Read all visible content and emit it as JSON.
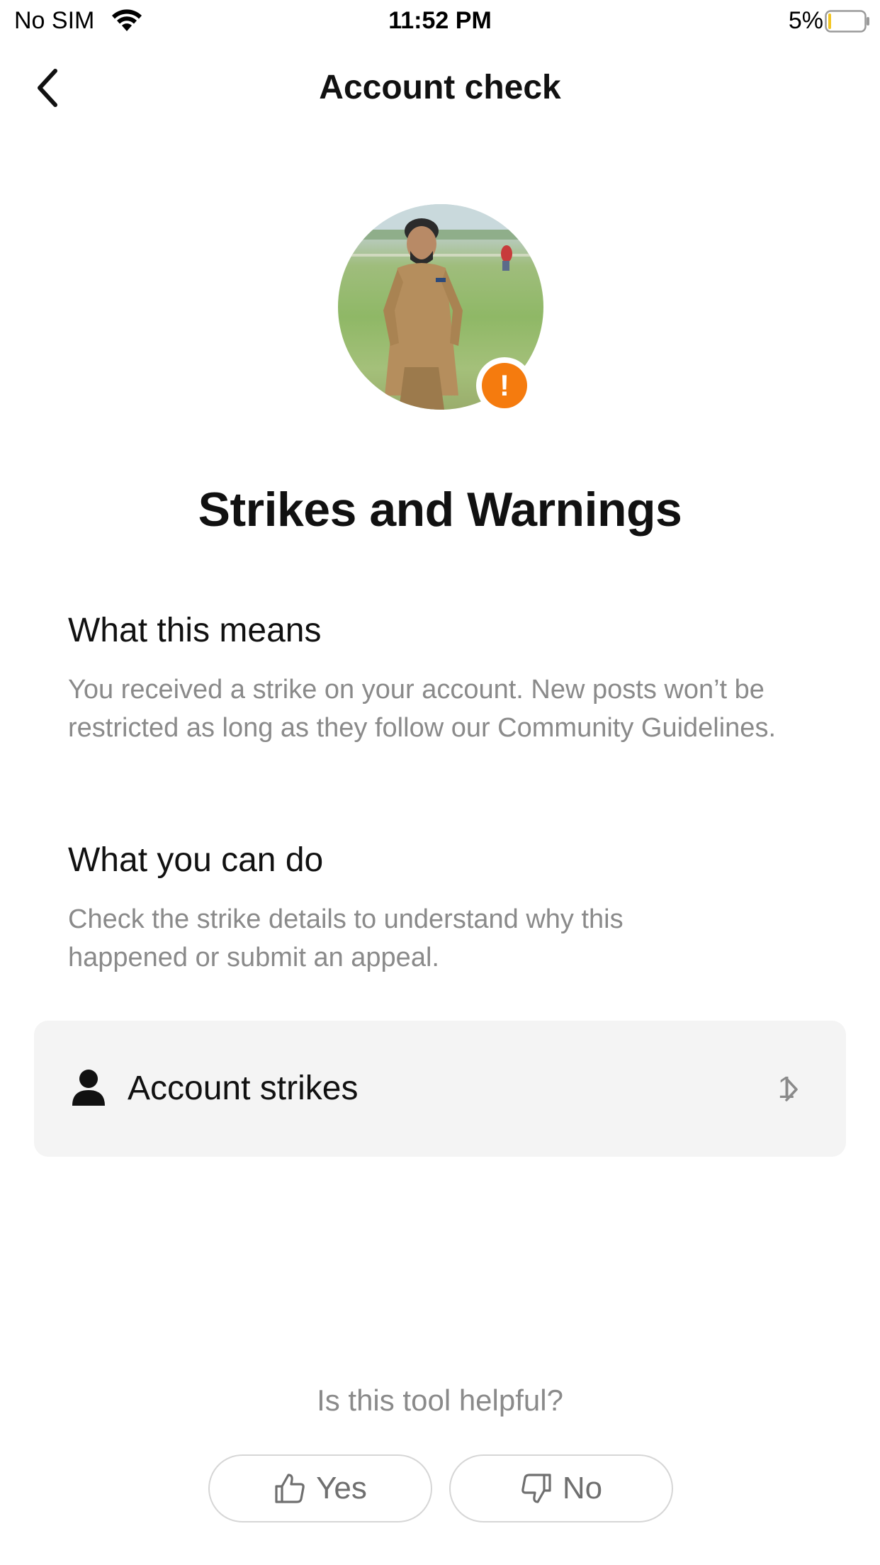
{
  "status_bar": {
    "carrier": "No SIM",
    "time": "11:52 PM",
    "battery_percent": "5%",
    "battery_level": 0.05,
    "wifi_icon": "wifi-icon",
    "battery_icon": "battery-icon"
  },
  "nav": {
    "title": "Account check",
    "back_icon": "chevron-left-icon"
  },
  "profile": {
    "avatar": "profile-photo",
    "badge_icon": "exclamation-icon",
    "badge_text": "!",
    "badge_color": "#f57b0e"
  },
  "main": {
    "title": "Strikes and Warnings",
    "sections": [
      {
        "heading": "What this means",
        "body": "You received a strike on your account. New posts won’t be restricted as long as they follow our Community Guidelines."
      },
      {
        "heading": "What you can do",
        "body": "Check the strike details to understand why this happened or submit an appeal."
      }
    ],
    "strikes_row": {
      "icon": "person-icon",
      "label": "Account strikes",
      "count": "1",
      "chevron_icon": "chevron-right-icon"
    }
  },
  "feedback": {
    "question": "Is this tool helpful?",
    "yes_label": "Yes",
    "yes_icon": "thumbs-up-icon",
    "no_label": "No",
    "no_icon": "thumbs-down-icon"
  }
}
